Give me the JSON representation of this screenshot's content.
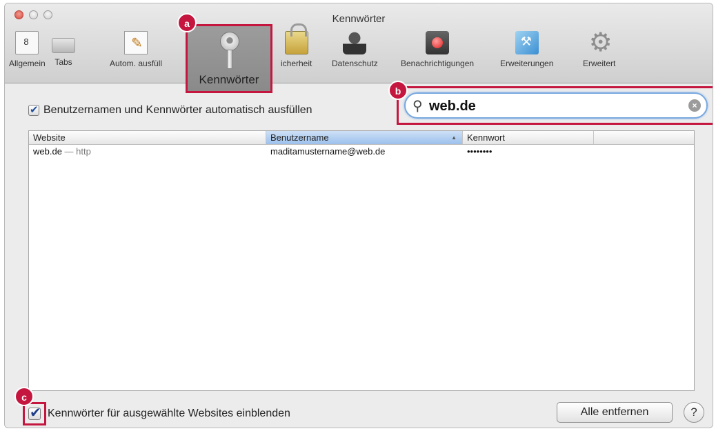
{
  "window": {
    "title": "Kennwörter"
  },
  "toolbar": {
    "items": [
      {
        "label": "Allgemein",
        "icon": "general-icon"
      },
      {
        "label": "Tabs",
        "icon": "tabs-icon"
      },
      {
        "label": "Autom. ausfüll",
        "icon": "autofill-icon"
      },
      {
        "label": "Kennwörter",
        "icon": "key-icon",
        "selected": true
      },
      {
        "label": "icherheit",
        "icon": "lock-icon"
      },
      {
        "label": "Datenschutz",
        "icon": "person-icon"
      },
      {
        "label": "Benachrichtigungen",
        "icon": "notification-icon"
      },
      {
        "label": "Erweiterungen",
        "icon": "extensions-icon"
      },
      {
        "label": "Erweitert",
        "icon": "gear-icon"
      }
    ]
  },
  "badges": {
    "a": "a",
    "b": "b",
    "c": "c"
  },
  "autofill": {
    "label": "Benutzernamen und Kennwörter automatisch ausfüllen",
    "checked": true
  },
  "search": {
    "value": "web.de"
  },
  "table": {
    "columns": [
      "Website",
      "Benutzername",
      "Kennwort",
      ""
    ],
    "sorted_column": "Benutzername",
    "rows": [
      {
        "website": "web.de",
        "protocol": "— http",
        "username": "maditamustername@web.de",
        "password": "••••••••"
      }
    ]
  },
  "show_passwords": {
    "label": "Kennwörter für ausgewählte Websites einblenden",
    "checked": true
  },
  "buttons": {
    "remove_all": "Alle entfernen",
    "help": "?"
  },
  "colors": {
    "highlight": "#c4163e",
    "focus_ring": "#7aa9e0",
    "sort_header": "#9cc0ec"
  }
}
